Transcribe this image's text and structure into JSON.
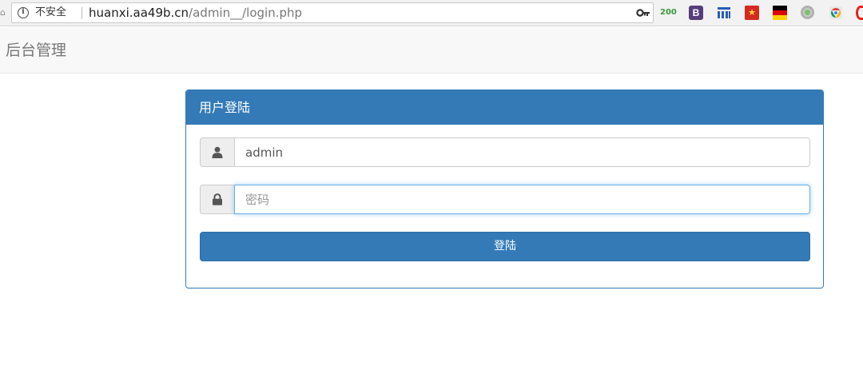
{
  "browser": {
    "security_label": "不安全",
    "url_host": "huanxi.aa49b.cn",
    "url_path": "/admin__/login.php",
    "extensions": {
      "status_code": "200",
      "bootstrap_letter": "B",
      "star_glyph": "★"
    },
    "colors": {
      "bootstrap": "#563d7c",
      "star_flag": "#d62a1e"
    }
  },
  "navbar": {
    "brand": "后台管理"
  },
  "login": {
    "heading": "用户登陆",
    "username_value": "admin",
    "password_placeholder": "密码",
    "submit_label": "登陆",
    "icons": {
      "username": "user-icon",
      "password": "lock-icon"
    }
  },
  "theme": {
    "primary": "#337ab7",
    "focus": "#66afe9"
  }
}
